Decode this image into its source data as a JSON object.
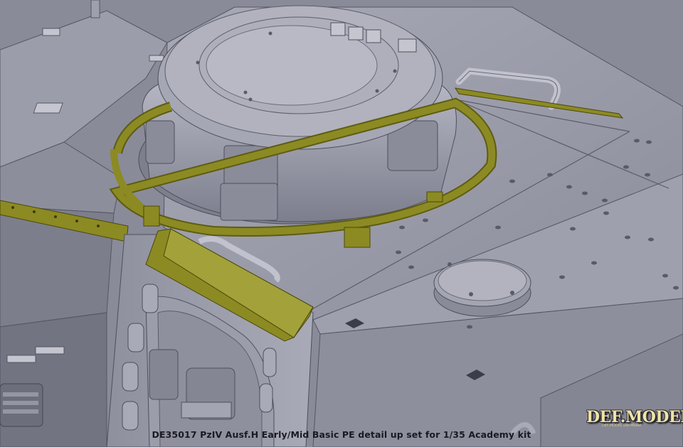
{
  "caption": "DE35017 PzIV Ausf.H Early/Mid Basic PE detail up set for 1/35 Academy kit",
  "brand": {
    "name": "DEF.MODEL",
    "subtitle": "DEF.MODEL Def.Model"
  },
  "colors": {
    "hull": "#9a9ba8",
    "hull_light": "#b9bac6",
    "hull_dark": "#6f7080",
    "photo_etch": "#8c8a22",
    "photo_etch_dark": "#5e5c12"
  }
}
